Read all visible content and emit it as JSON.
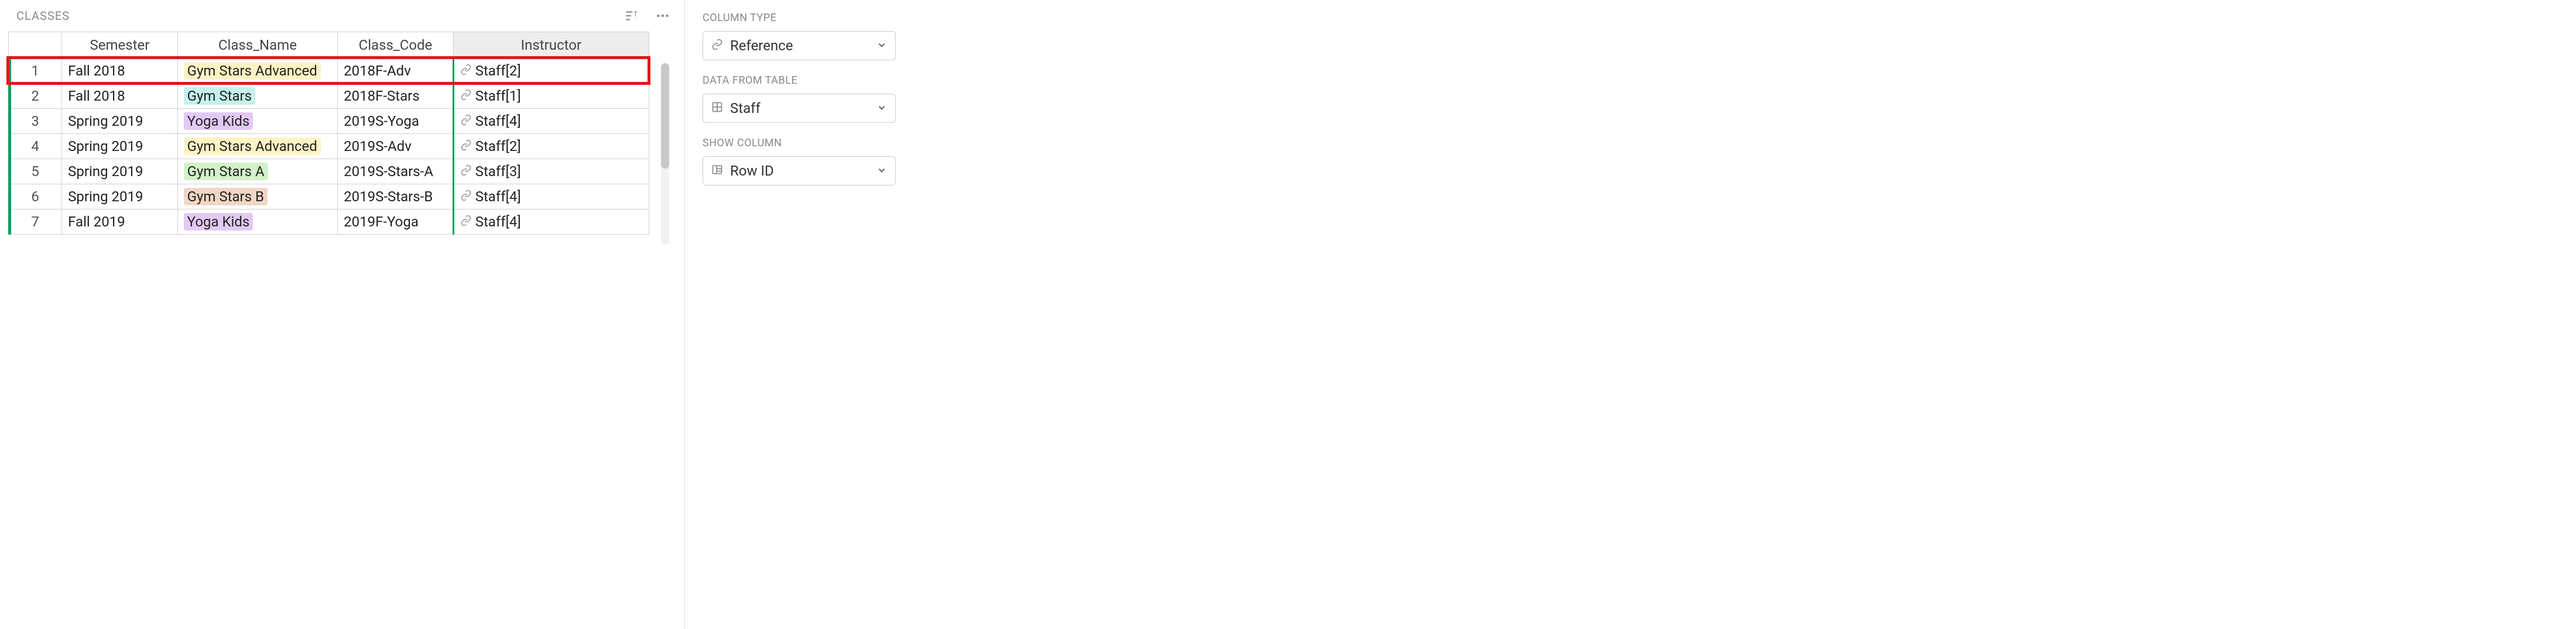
{
  "table_title": "CLASSES",
  "columns": {
    "semester": "Semester",
    "class_name": "Class_Name",
    "class_code": "Class_Code",
    "instructor": "Instructor"
  },
  "rows": [
    {
      "num": "1",
      "semester": "Fall 2018",
      "class_name": "Gym Stars Advanced",
      "class_tag": "yellow",
      "class_code": "2018F-Adv",
      "instructor": "Staff[2]",
      "highlighted": true
    },
    {
      "num": "2",
      "semester": "Fall 2018",
      "class_name": "Gym Stars",
      "class_tag": "cyan",
      "class_code": "2018F-Stars",
      "instructor": "Staff[1]"
    },
    {
      "num": "3",
      "semester": "Spring 2019",
      "class_name": "Yoga Kids",
      "class_tag": "purple",
      "class_code": "2019S-Yoga",
      "instructor": "Staff[4]"
    },
    {
      "num": "4",
      "semester": "Spring 2019",
      "class_name": "Gym Stars Advanced",
      "class_tag": "yellow",
      "class_code": "2019S-Adv",
      "instructor": "Staff[2]"
    },
    {
      "num": "5",
      "semester": "Spring 2019",
      "class_name": "Gym Stars A",
      "class_tag": "green",
      "class_code": "2019S-Stars-A",
      "instructor": "Staff[3]"
    },
    {
      "num": "6",
      "semester": "Spring 2019",
      "class_name": "Gym Stars B",
      "class_tag": "tan",
      "class_code": "2019S-Stars-B",
      "instructor": "Staff[4]"
    },
    {
      "num": "7",
      "semester": "Fall 2019",
      "class_name": "Yoga Kids",
      "class_tag": "purple",
      "class_code": "2019F-Yoga",
      "instructor": "Staff[4]"
    }
  ],
  "side": {
    "column_type_label": "COLUMN TYPE",
    "column_type_value": "Reference",
    "data_from_table_label": "DATA FROM TABLE",
    "data_from_table_value": "Staff",
    "show_column_label": "SHOW COLUMN",
    "show_column_value": "Row ID"
  }
}
